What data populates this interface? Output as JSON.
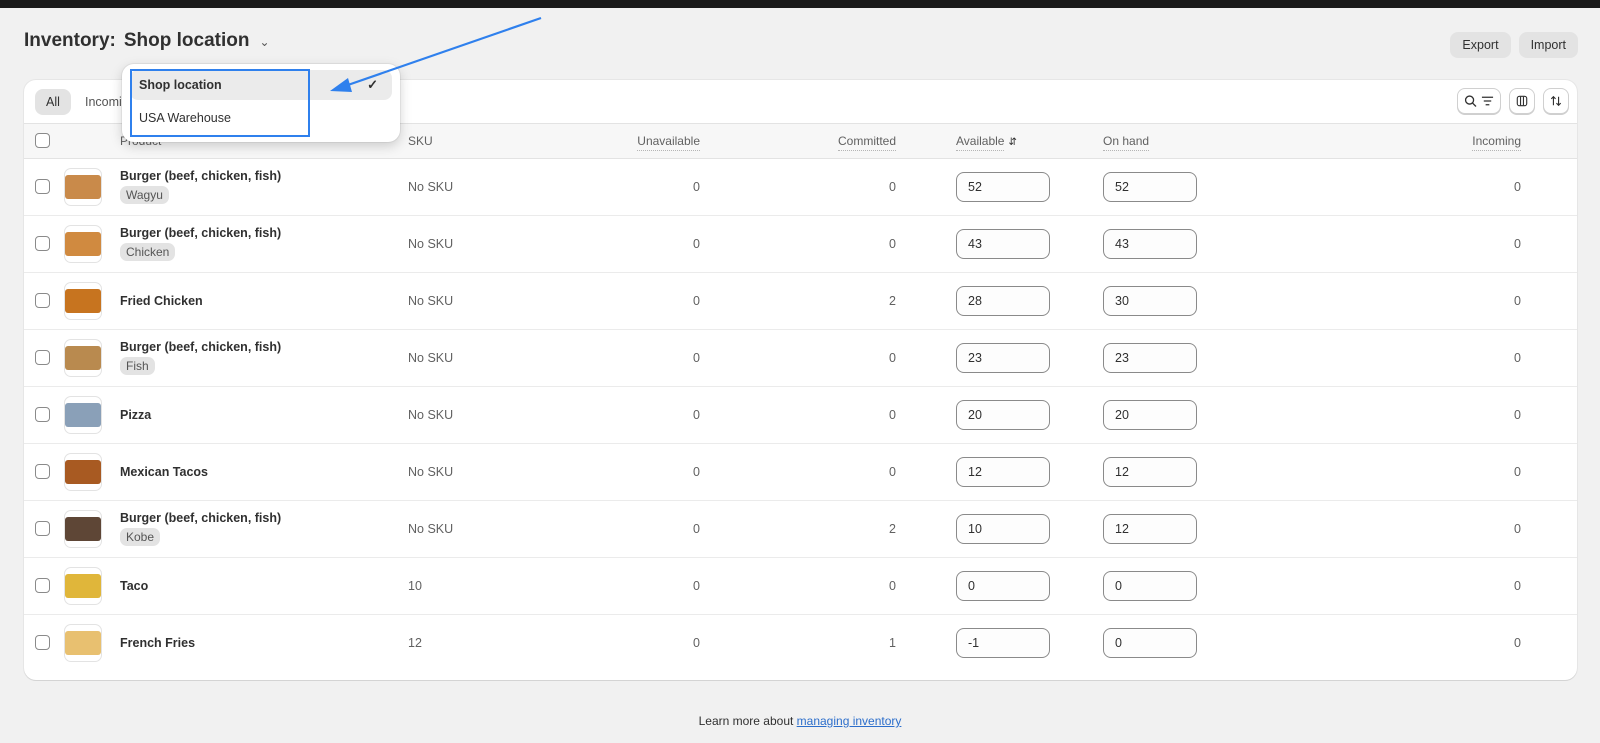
{
  "header": {
    "title_prefix": "Inventory:",
    "location": "Shop location",
    "export_label": "Export",
    "import_label": "Import"
  },
  "location_dropdown": {
    "options": [
      {
        "label": "Shop location",
        "selected": true
      },
      {
        "label": "USA Warehouse",
        "selected": false
      }
    ]
  },
  "tabs": [
    {
      "label": "All",
      "active": true
    },
    {
      "label": "Incoming",
      "active": false
    }
  ],
  "toolbar": {
    "icons": [
      "search-filter-icon",
      "columns-icon",
      "sort-icon"
    ]
  },
  "table": {
    "columns": [
      "Product",
      "SKU",
      "Unavailable",
      "Committed",
      "Available",
      "On hand",
      "Incoming"
    ],
    "rows": [
      {
        "product": "Burger (beef, chicken, fish)",
        "variant": "Wagyu",
        "sku": "No SKU",
        "unavailable": "0",
        "committed": "0",
        "available": "52",
        "on_hand": "52",
        "incoming": "0",
        "thumb_color": "#c98a4a"
      },
      {
        "product": "Burger (beef, chicken, fish)",
        "variant": "Chicken",
        "sku": "No SKU",
        "unavailable": "0",
        "committed": "0",
        "available": "43",
        "on_hand": "43",
        "incoming": "0",
        "thumb_color": "#d08a40"
      },
      {
        "product": "Fried Chicken",
        "variant": "",
        "sku": "No SKU",
        "unavailable": "0",
        "committed": "2",
        "available": "28",
        "on_hand": "30",
        "incoming": "0",
        "thumb_color": "#c7741f"
      },
      {
        "product": "Burger (beef, chicken, fish)",
        "variant": "Fish",
        "sku": "No SKU",
        "unavailable": "0",
        "committed": "0",
        "available": "23",
        "on_hand": "23",
        "incoming": "0",
        "thumb_color": "#b98a4f"
      },
      {
        "product": "Pizza",
        "variant": "",
        "sku": "No SKU",
        "unavailable": "0",
        "committed": "0",
        "available": "20",
        "on_hand": "20",
        "incoming": "0",
        "thumb_color": "#8aa0b8"
      },
      {
        "product": "Mexican Tacos",
        "variant": "",
        "sku": "No SKU",
        "unavailable": "0",
        "committed": "0",
        "available": "12",
        "on_hand": "12",
        "incoming": "0",
        "thumb_color": "#a85a22"
      },
      {
        "product": "Burger (beef, chicken, fish)",
        "variant": "Kobe",
        "sku": "No SKU",
        "unavailable": "0",
        "committed": "2",
        "available": "10",
        "on_hand": "12",
        "incoming": "0",
        "thumb_color": "#5e4636"
      },
      {
        "product": "Taco",
        "variant": "",
        "sku": "10",
        "unavailable": "0",
        "committed": "0",
        "available": "0",
        "on_hand": "0",
        "incoming": "0",
        "thumb_color": "#e0b63a"
      },
      {
        "product": "French Fries",
        "variant": "",
        "sku": "12",
        "unavailable": "0",
        "committed": "1",
        "available": "-1",
        "on_hand": "0",
        "incoming": "0",
        "thumb_color": "#e8c070"
      }
    ]
  },
  "footer": {
    "text": "Learn more about ",
    "link": "managing inventory"
  },
  "colors": {
    "accent": "#2f80ed",
    "link": "#2c6ecb",
    "background": "#f1f1f1"
  }
}
